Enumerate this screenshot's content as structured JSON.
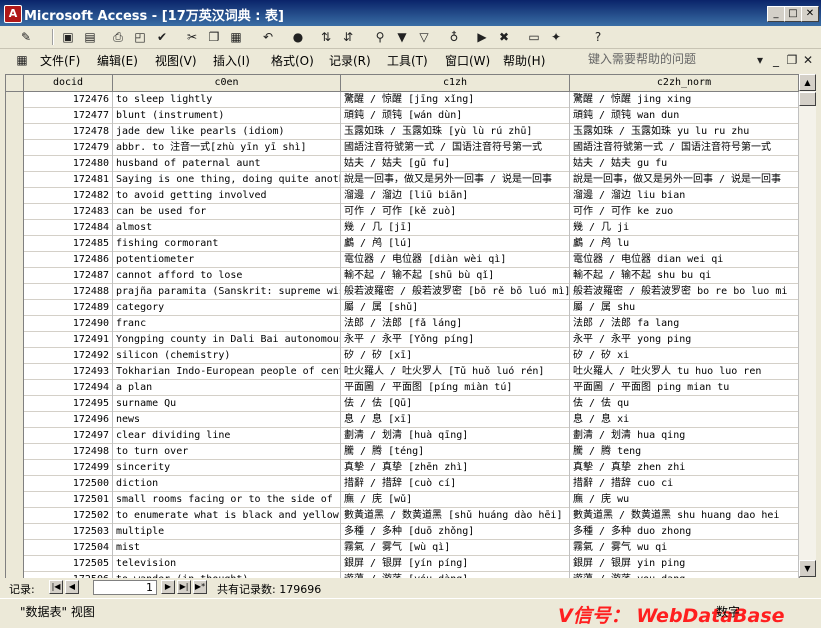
{
  "window": {
    "title": "Microsoft Access - [17万英汉词典 : 表]",
    "app_letter": "A"
  },
  "menu": {
    "items": [
      "文件(F)",
      "编辑(E)",
      "视图(V)",
      "插入(I)",
      "格式(O)",
      "记录(R)",
      "工具(T)",
      "窗口(W)",
      "帮助(H)"
    ],
    "help_placeholder": "键入需要帮助的问题"
  },
  "table": {
    "columns": [
      "docid",
      "c0en",
      "c1zh",
      "c2zh_norm"
    ],
    "rows": [
      {
        "docid": "172476",
        "c0en": "to sleep lightly",
        "c1zh": "驚醒 / 惊醒 [jīng xǐng]",
        "c2zh_norm": "驚醒 / 惊醒 jing xing"
      },
      {
        "docid": "172477",
        "c0en": "blunt (instrument)",
        "c1zh": "頑鈍 / 顽钝 [wán dùn]",
        "c2zh_norm": "頑鈍 / 顽钝 wan dun"
      },
      {
        "docid": "172478",
        "c0en": "jade dew like pearls (idiom)",
        "c1zh": "玉露如珠 / 玉露如珠 [yù lù rú zhū]",
        "c2zh_norm": "玉露如珠 / 玉露如珠 yu lu ru zhu"
      },
      {
        "docid": "172479",
        "c0en": "abbr. to 注音一式[zhù yīn yī shì]",
        "c1zh": "國語注音符號第一式 / 国语注音符号第一式",
        "c2zh_norm": "國語注音符號第一式 / 国语注音符号第一式"
      },
      {
        "docid": "172480",
        "c0en": "husband of paternal aunt",
        "c1zh": "姑夫 / 姑夫 [gū fu]",
        "c2zh_norm": "姑夫 / 姑夫 gu fu"
      },
      {
        "docid": "172481",
        "c0en": "Saying is one thing, doing quite another",
        "c1zh": "說是一回事，做又是另外一回事 / 说是一回事",
        "c2zh_norm": "說是一回事，做又是另外一回事 / 说是一回事"
      },
      {
        "docid": "172482",
        "c0en": "to avoid getting involved",
        "c1zh": "溜邊 / 溜边 [liū biān]",
        "c2zh_norm": "溜邊 / 溜边 liu bian"
      },
      {
        "docid": "172483",
        "c0en": "can be used for",
        "c1zh": "可作 / 可作 [kě zuò]",
        "c2zh_norm": "可作 / 可作 ke zuo"
      },
      {
        "docid": "172484",
        "c0en": "almost",
        "c1zh": "幾 / 几 [jī]",
        "c2zh_norm": "幾 / 几 ji"
      },
      {
        "docid": "172485",
        "c0en": "fishing cormorant",
        "c1zh": "鸕 / 鸬 [lú]",
        "c2zh_norm": "鸕 / 鸬 lu"
      },
      {
        "docid": "172486",
        "c0en": "potentiometer",
        "c1zh": "電位器 / 电位器 [diàn wèi qì]",
        "c2zh_norm": "電位器 / 电位器 dian wei qi"
      },
      {
        "docid": "172487",
        "c0en": "cannot afford to lose",
        "c1zh": "輸不起 / 输不起 [shū bù qǐ]",
        "c2zh_norm": "輸不起 / 输不起 shu bu qi"
      },
      {
        "docid": "172488",
        "c0en": "prajña paramita (Sanskrit: supreme wisdom)",
        "c1zh": "般若波羅密 / 般若波罗密 [bō rě bō luó mì]",
        "c2zh_norm": "般若波羅密 / 般若波罗密 bo re bo luo mi"
      },
      {
        "docid": "172489",
        "c0en": "category",
        "c1zh": "屬 / 属 [shǔ]",
        "c2zh_norm": "屬 / 属 shu"
      },
      {
        "docid": "172490",
        "c0en": "franc",
        "c1zh": "法郎 / 法郎 [fǎ láng]",
        "c2zh_norm": "法郎 / 法郎 fa lang"
      },
      {
        "docid": "172491",
        "c0en": "Yongping county in Dali Bai autonomous",
        "c1zh": "永平 / 永平 [Yǒng píng]",
        "c2zh_norm": "永平 / 永平 yong ping"
      },
      {
        "docid": "172492",
        "c0en": "silicon (chemistry)",
        "c1zh": "矽 / 矽 [xī]",
        "c2zh_norm": "矽 / 矽 xi"
      },
      {
        "docid": "172493",
        "c0en": "Tokharian Indo-European people of central",
        "c1zh": "吐火羅人 / 吐火罗人 [Tǔ huǒ luó rén]",
        "c2zh_norm": "吐火羅人 / 吐火罗人 tu huo luo ren"
      },
      {
        "docid": "172494",
        "c0en": "a plan",
        "c1zh": "平面圖 / 平面图 [píng miàn tú]",
        "c2zh_norm": "平面圖 / 平面图 ping mian tu"
      },
      {
        "docid": "172495",
        "c0en": "surname Qu",
        "c1zh": "佉 / 佉 [Qū]",
        "c2zh_norm": "佉 / 佉 qu"
      },
      {
        "docid": "172496",
        "c0en": "news",
        "c1zh": "息 / 息 [xī]",
        "c2zh_norm": "息 / 息 xi"
      },
      {
        "docid": "172497",
        "c0en": "clear dividing line",
        "c1zh": "劃清 / 划清 [huà qīng]",
        "c2zh_norm": "劃清 / 划清 hua qing"
      },
      {
        "docid": "172498",
        "c0en": "to turn over",
        "c1zh": "騰 / 腾 [téng]",
        "c2zh_norm": "騰 / 腾 teng"
      },
      {
        "docid": "172499",
        "c0en": "sincerity",
        "c1zh": "真摯 / 真挚 [zhēn zhì]",
        "c2zh_norm": "真摯 / 真挚 zhen zhi"
      },
      {
        "docid": "172500",
        "c0en": "diction",
        "c1zh": "措辭 / 措辞 [cuò cí]",
        "c2zh_norm": "措辭 / 措辞 cuo ci"
      },
      {
        "docid": "172501",
        "c0en": "small rooms facing or to the side of",
        "c1zh": "廡 / 庑 [wǔ]",
        "c2zh_norm": "廡 / 庑 wu"
      },
      {
        "docid": "172502",
        "c0en": "to enumerate what is black and yellow",
        "c1zh": "數黃道黑 / 数黄道黑 [shǔ huáng dào hēi]",
        "c2zh_norm": "數黃道黑 / 数黄道黑 shu huang dao hei"
      },
      {
        "docid": "172503",
        "c0en": "multiple",
        "c1zh": "多種 / 多种 [duō zhǒng]",
        "c2zh_norm": "多種 / 多种 duo zhong"
      },
      {
        "docid": "172504",
        "c0en": "mist",
        "c1zh": "霧氣 / 雾气 [wù qì]",
        "c2zh_norm": "霧氣 / 雾气 wu qi"
      },
      {
        "docid": "172505",
        "c0en": "television",
        "c1zh": "銀屏 / 银屏 [yín píng]",
        "c2zh_norm": "銀屏 / 银屏 yin ping"
      },
      {
        "docid": "172506",
        "c0en": "to wander (in thought)",
        "c1zh": "遊蕩 / 游荡 [yóu dàng]",
        "c2zh_norm": "遊蕩 / 游荡 you dang"
      }
    ]
  },
  "nav": {
    "label": "记录:",
    "current": "1",
    "total_label": "共有记录数: 179696"
  },
  "status": {
    "text": "\"数据表\" 视图",
    "mode": "数字",
    "watermark": "V信号： WebDataBase"
  }
}
